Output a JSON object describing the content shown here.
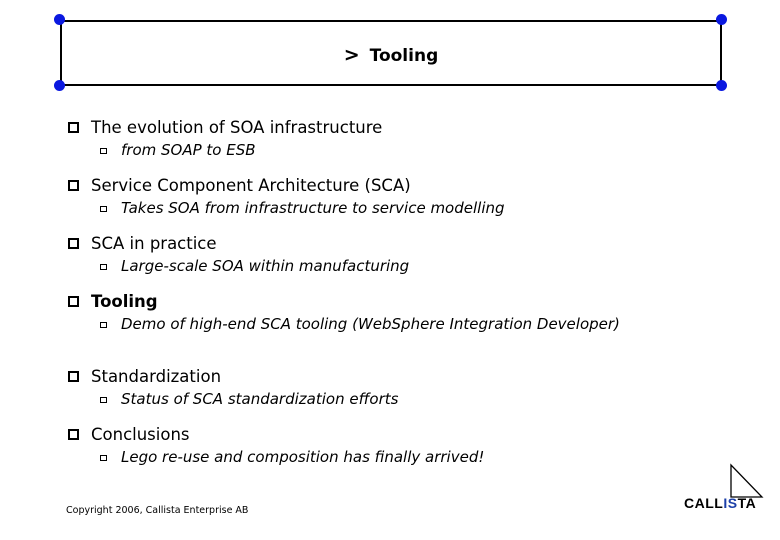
{
  "slide": {
    "title_prefix": ">",
    "title": "Tooling"
  },
  "outline": [
    {
      "label": "The evolution of SOA infrastructure",
      "sub": "from SOAP to ESB",
      "current": false
    },
    {
      "label": "Service Component Architecture (SCA)",
      "sub": "Takes SOA from infrastructure to service modelling",
      "current": false
    },
    {
      "label": "SCA in practice",
      "sub": "Large-scale SOA within manufacturing",
      "current": false
    },
    {
      "label": "Tooling",
      "sub": "Demo of high-end SCA tooling (WebSphere Integration Developer)",
      "current": true
    },
    {
      "label": "Standardization",
      "sub": "Status of SCA standardization efforts",
      "current": false
    },
    {
      "label": "Conclusions",
      "sub": "Lego re-use and composition has finally arrived!",
      "current": false
    }
  ],
  "footer": {
    "copyright": "Copyright 2006, Callista Enterprise AB"
  },
  "logo": {
    "part1": "CALL",
    "part2": "IS",
    "part3": "TA",
    "accent_color": "#1b3fa8"
  }
}
